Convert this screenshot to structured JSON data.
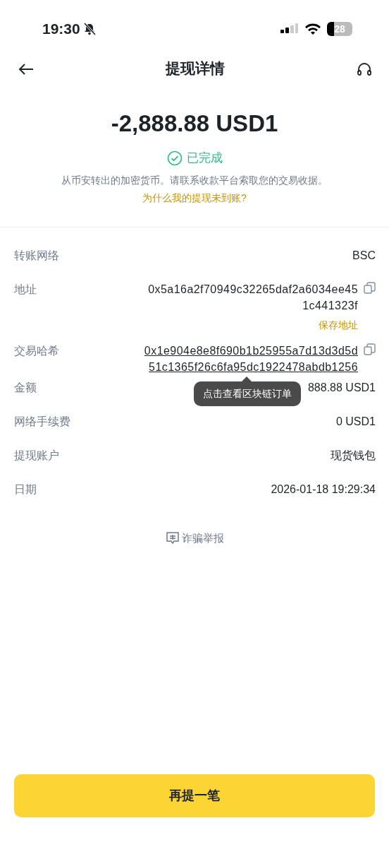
{
  "status_bar": {
    "time": "19:30",
    "battery": "28"
  },
  "header": {
    "title": "提现详情"
  },
  "summary": {
    "amount": "-2,888.88 USD1",
    "status": "已完成",
    "note": "从币安转出的加密货币。请联系收款平台索取您的交易收据。",
    "help_link": "为什么我的提现未到账?"
  },
  "details": [
    {
      "kind": "plain",
      "label": "转账网络",
      "value": "BSC"
    },
    {
      "kind": "address",
      "label": "地址",
      "value": "0x5a16a2f70949c32265daf2a6034ee451c441323f",
      "action": "保存地址"
    },
    {
      "kind": "hash",
      "label": "交易哈希",
      "value": "0x1e904e8e8f690b1b25955a7d13d3d5d51c1365f26c6fa95dc1922478abdb1256",
      "tooltip": "点击查看区块链订单"
    },
    {
      "kind": "plain",
      "label": "金额",
      "value": "888.88 USD1"
    },
    {
      "kind": "plain",
      "label": "网络手续费",
      "value": "0 USD1"
    },
    {
      "kind": "plain",
      "label": "提现账户",
      "value": "现货钱包"
    },
    {
      "kind": "plain",
      "label": "日期",
      "value": "2026-01-18 19:29:34"
    }
  ],
  "report_link": "诈骗举报",
  "primary_button": "再提一笔"
}
